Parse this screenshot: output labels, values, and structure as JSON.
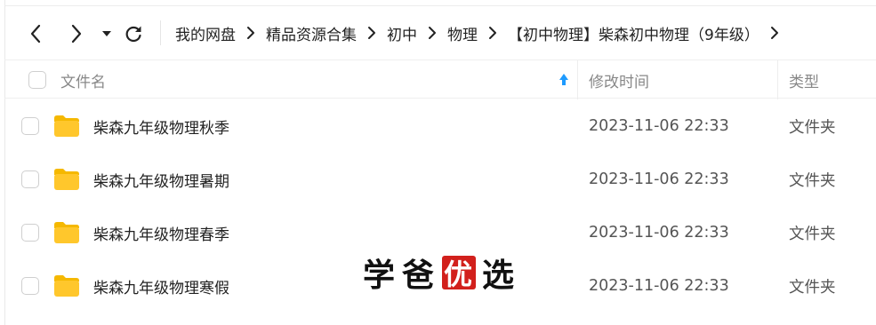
{
  "toolbar": {
    "back_icon": "chevron-left-icon",
    "forward_icon": "chevron-right-icon",
    "dropdown_icon": "caret-down-icon",
    "refresh_icon": "refresh-icon"
  },
  "breadcrumb": [
    "我的网盘",
    "精品资源合集",
    "初中",
    "物理",
    "【初中物理】柴森初中物理（9年级）"
  ],
  "table": {
    "columns": {
      "name": "文件名",
      "modified": "修改时间",
      "type": "类型"
    },
    "sort_icon": "sort-up-arrow-icon",
    "rows": [
      {
        "name": "柴森九年级物理秋季",
        "modified": "2023-11-06 22:33",
        "type": "文件夹"
      },
      {
        "name": "柴森九年级物理暑期",
        "modified": "2023-11-06 22:33",
        "type": "文件夹"
      },
      {
        "name": "柴森九年级物理春季",
        "modified": "2023-11-06 22:33",
        "type": "文件夹"
      },
      {
        "name": "柴森九年级物理寒假",
        "modified": "2023-11-06 22:33",
        "type": "文件夹"
      }
    ]
  },
  "watermark": {
    "chars": [
      "学",
      "爸",
      "优",
      "选"
    ]
  },
  "colors": {
    "folder": "#FFC72C",
    "folder_tab": "#F5B800",
    "sort_arrow": "#1E9BFF",
    "stamp": "#D2201C"
  }
}
